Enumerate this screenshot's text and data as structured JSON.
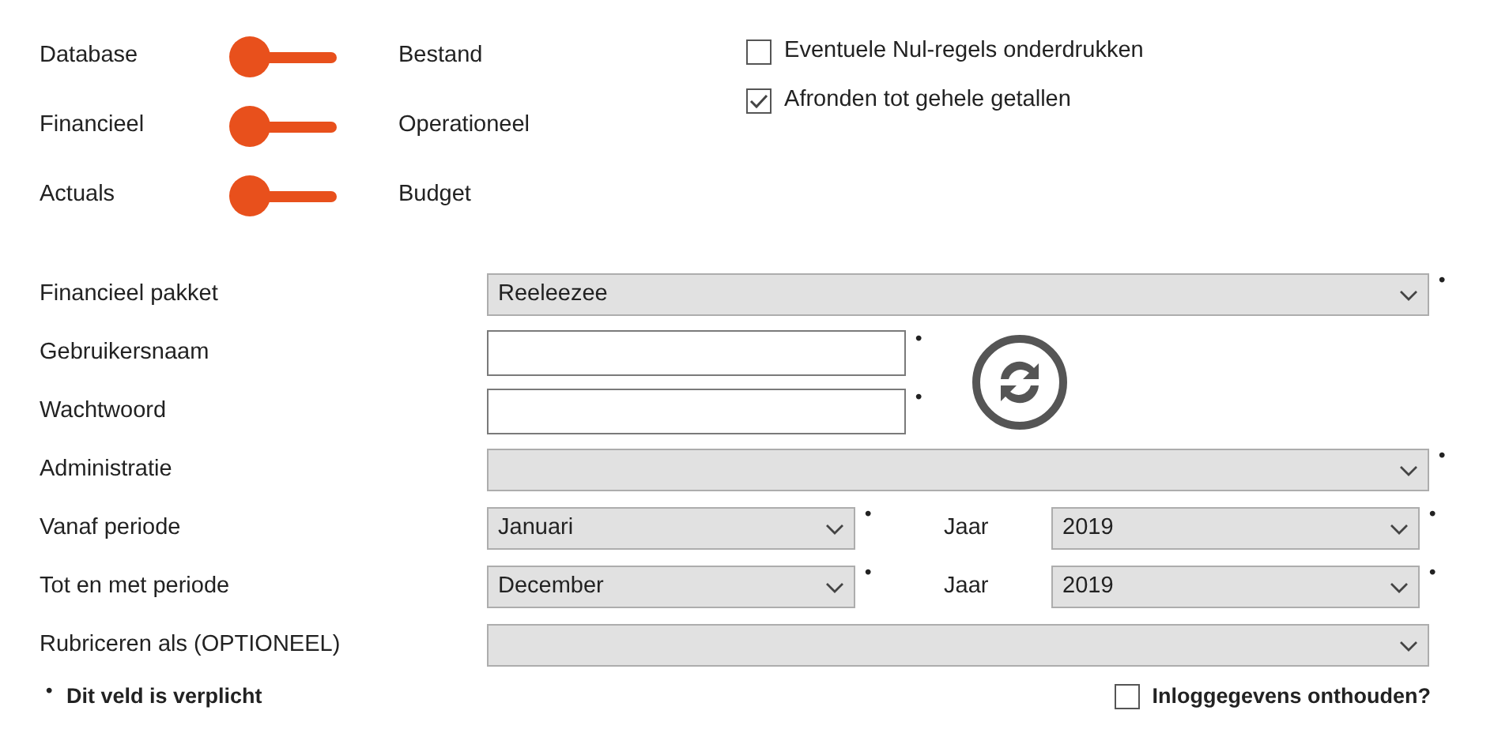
{
  "toggles": [
    {
      "left_label": "Database",
      "right_label": "Bestand",
      "on": false
    },
    {
      "left_label": "Financieel",
      "right_label": "Operationeel",
      "on": false
    },
    {
      "left_label": "Actuals",
      "right_label": "Budget",
      "on": false
    }
  ],
  "options": [
    {
      "label": "Eventuele Nul-regels onderdrukken",
      "checked": false
    },
    {
      "label": "Afronden tot gehele getallen",
      "checked": true
    }
  ],
  "fields": [
    {
      "kind": "select",
      "label": "Financieel pakket",
      "value": "Reeleezee",
      "required_mark": "•"
    },
    {
      "kind": "text",
      "label": "Gebruikersnaam",
      "required_mark": "•"
    },
    {
      "kind": "text",
      "label": "Wachtwoord",
      "required_mark": "•"
    },
    {
      "kind": "select",
      "label": "Administratie",
      "required_mark": "•"
    },
    {
      "kind": "period",
      "label": "Vanaf periode",
      "value": "Januari",
      "required_mark": "•",
      "year_label": "Jaar",
      "year_value": "2019",
      "year_required_mark": "•"
    },
    {
      "kind": "period",
      "label": "Tot en met periode",
      "value": "December",
      "required_mark": "•",
      "year_label": "Jaar",
      "year_value": "2019",
      "year_required_mark": "•"
    },
    {
      "kind": "select",
      "label": "Rubriceren als (OPTIONEEL)"
    }
  ],
  "footer": {
    "required_mark": "•",
    "note": "Dit veld is verplicht",
    "remember": {
      "label": "Inloggegevens onthouden?",
      "checked": false
    }
  }
}
